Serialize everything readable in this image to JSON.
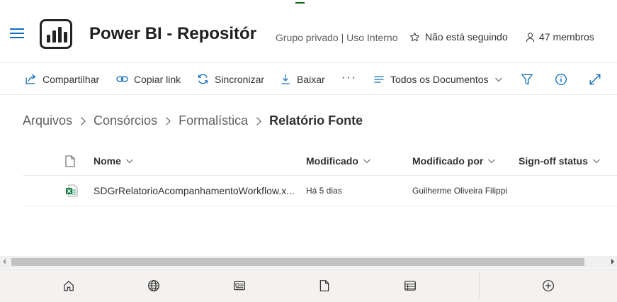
{
  "header": {
    "title": "Power BI - Repositór",
    "group_info": "Grupo privado | Uso Interno",
    "follow_label": "Não está seguindo",
    "members_label": "47 membros"
  },
  "toolbar": {
    "share": "Compartilhar",
    "copy_link": "Copiar link",
    "sync": "Sincronizar",
    "download": "Baixar",
    "more": "···",
    "view": "Todos os Documentos"
  },
  "breadcrumb": [
    "Arquivos",
    "Consórcios",
    "Formalística",
    "Relatório Fonte"
  ],
  "table": {
    "columns": [
      "Nome",
      "Modificado",
      "Modificado por",
      "Sign-off status"
    ],
    "rows": [
      {
        "name": "SDGrRelatorioAcompanhamentoWorkflow.x...",
        "modified": "Há 5 dias",
        "modified_by": "Guilherme Oliveira Filippi",
        "signoff": ""
      }
    ]
  },
  "colors": {
    "accent": "#0f6cbd",
    "excel": "#107c41",
    "top_accent": "#0b6a0b"
  },
  "icons": {
    "app_launcher": "hamburger-icon",
    "logo": "power-bi-logo",
    "bottom_nav": [
      "home-icon",
      "globe-icon",
      "news-icon",
      "document-icon",
      "list-icon",
      "add-icon"
    ]
  }
}
